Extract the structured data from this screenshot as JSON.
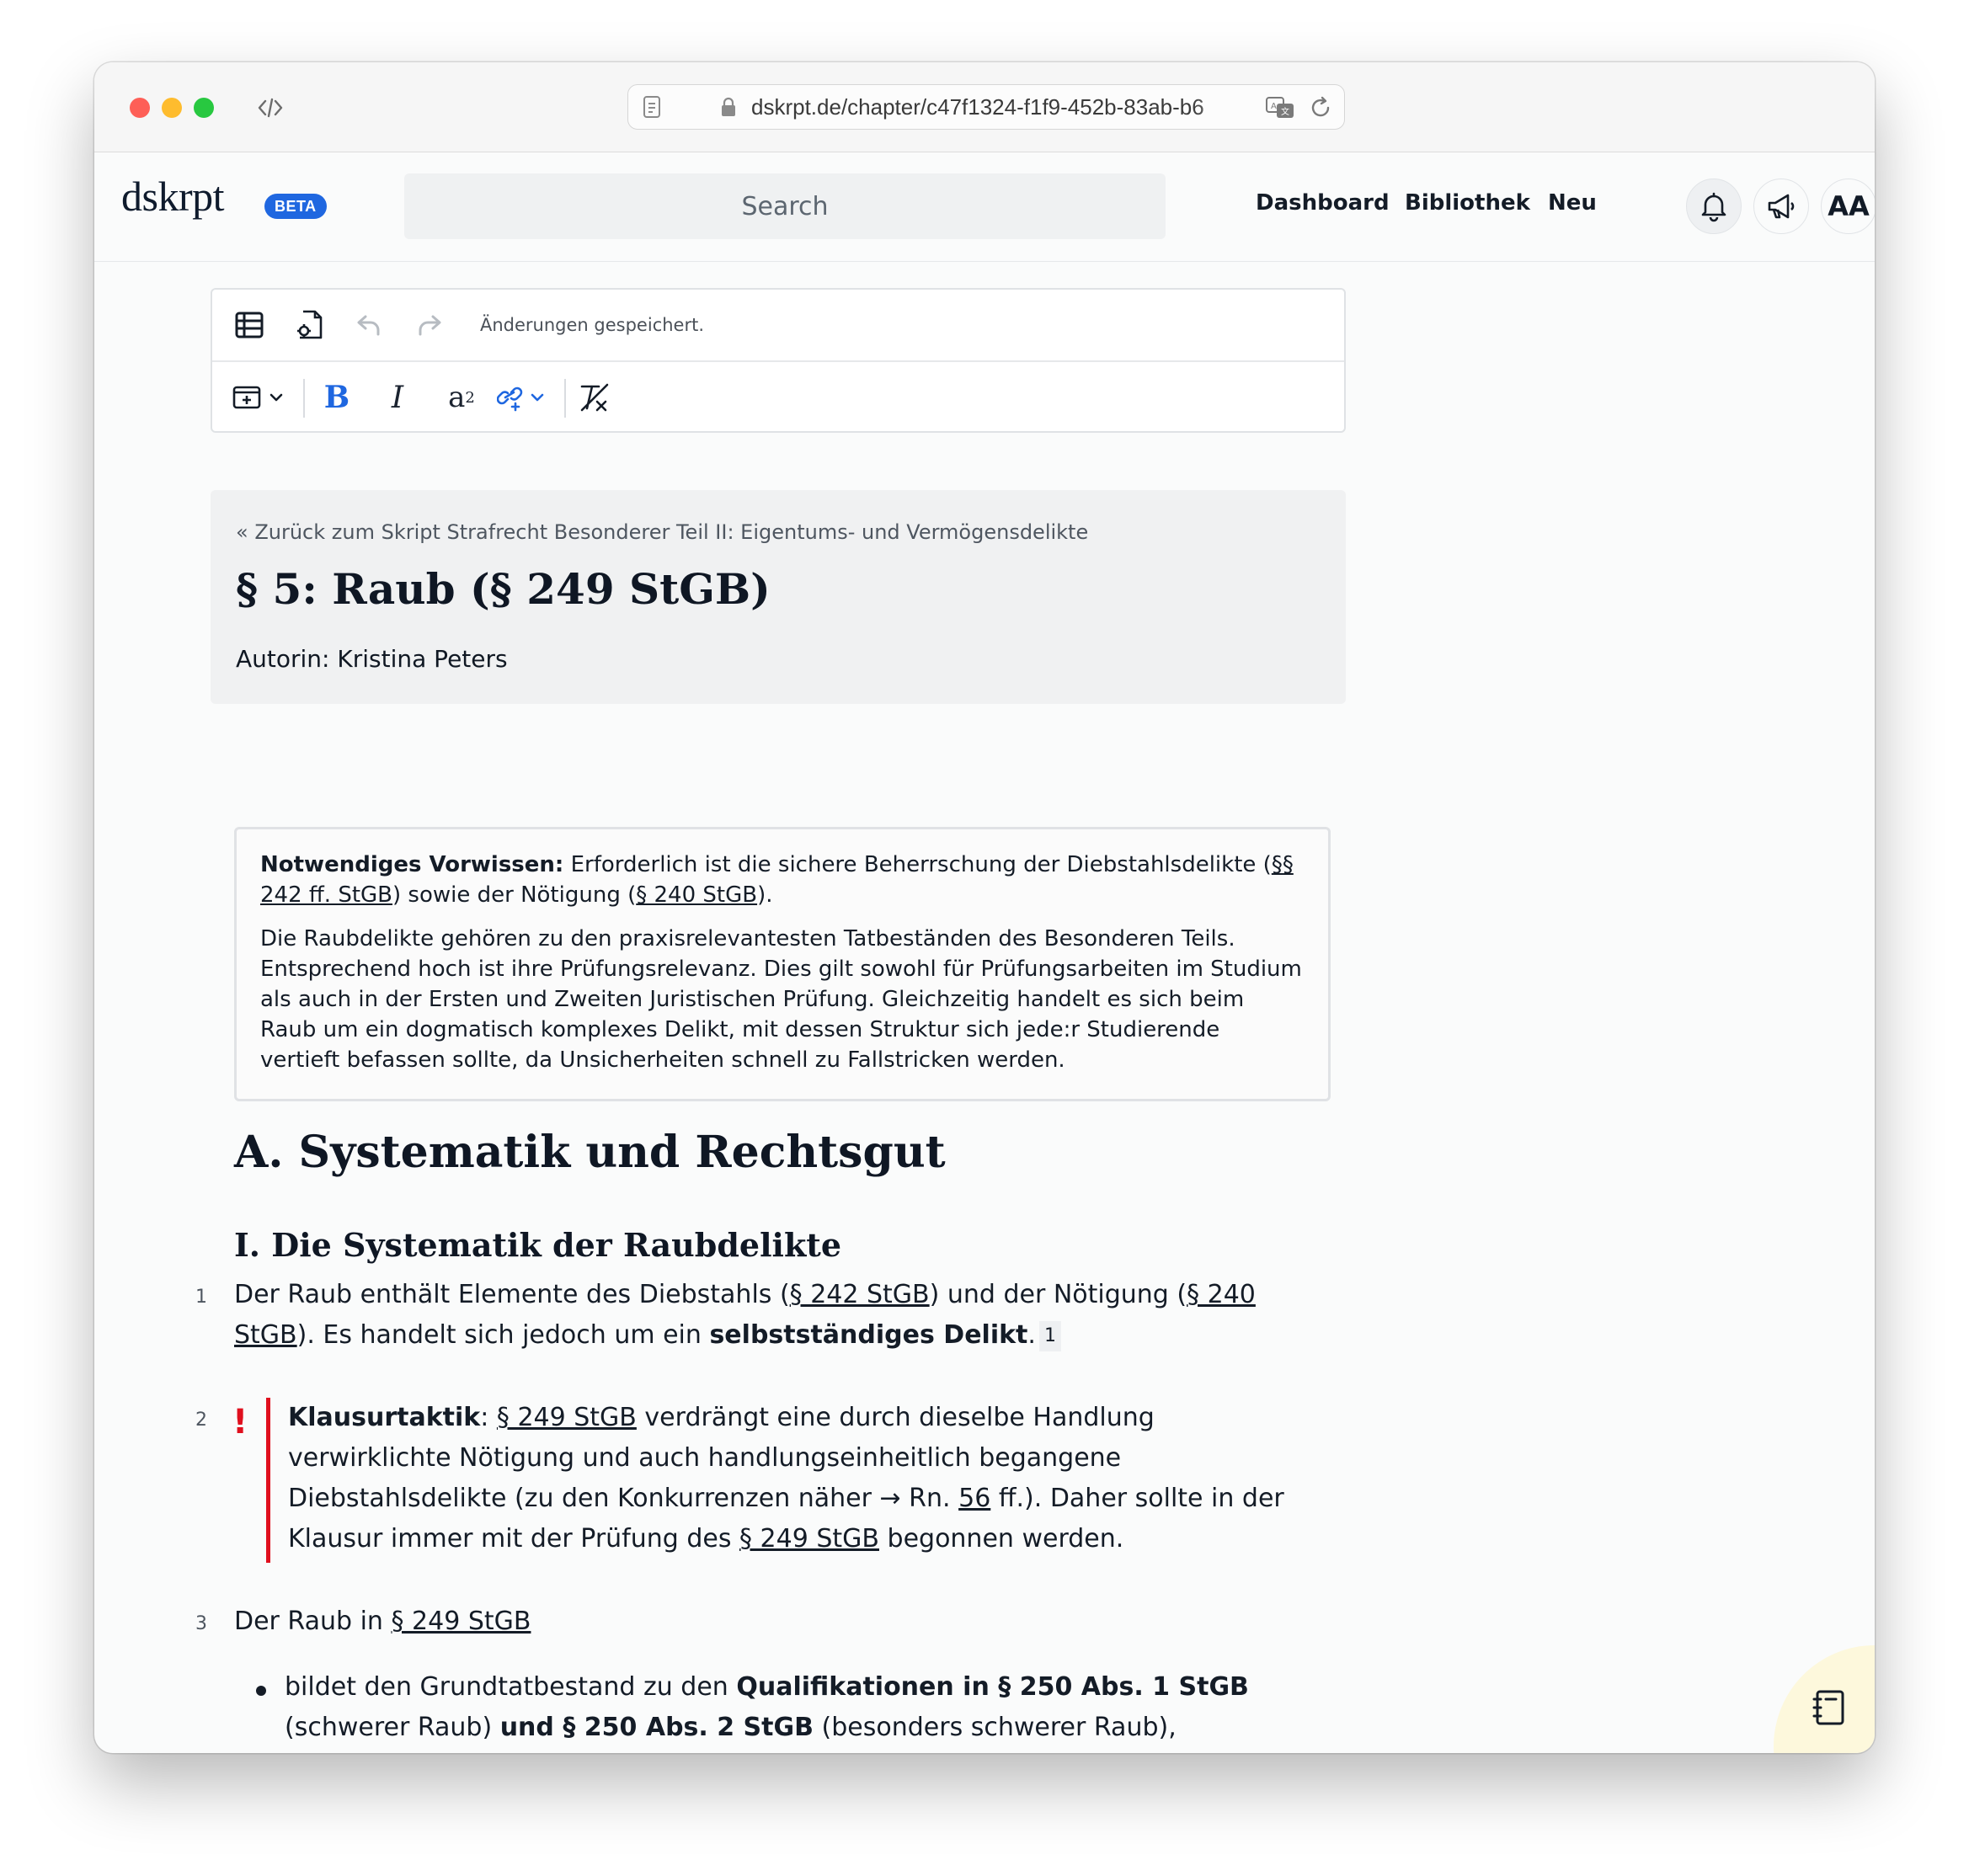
{
  "browser": {
    "url": "dskrpt.de/chapter/c47f1324-f1f9-452b-83ab-b6"
  },
  "header": {
    "logo": "dskrpt",
    "badge": "BETA",
    "search_placeholder": "Search",
    "nav": [
      "Dashboard",
      "Bibliothek",
      "Neu"
    ],
    "font_button": "AA"
  },
  "toolbar": {
    "status": "Änderungen gespeichert."
  },
  "chapter": {
    "back_link": "« Zurück zum Skript Strafrecht Besonderer Teil II: Eigentums- und Vermögensdelikte",
    "title": "§ 5: Raub (§ 249 StGB)",
    "author": "Autorin: Kristina Peters"
  },
  "infobox": {
    "label": "Notwendiges Vorwissen:",
    "text1": " Erforderlich ist die sichere Beherrschung der Diebstahlsdelikte (",
    "link1": "§§ 242 ff. StGB",
    "text2": ") sowie der Nötigung (",
    "link2": "§ 240 StGB",
    "text3": ").",
    "paragraph": "Die Raubdelikte gehören zu den praxisrelevantesten Tatbeständen des Besonderen Teils. Entsprechend hoch ist ihre Prüfungsrelevanz. Dies gilt sowohl für Prüfungsarbeiten im Studium als auch in der Ersten und Zweiten Juristischen Prüfung. Gleichzeitig handelt es sich beim Raub um ein dogmatisch komplexes Delikt, mit dessen Struktur sich jede:r Studierende vertieft befassen sollte, da Unsicherheiten schnell zu Fallstricken werden."
  },
  "content": {
    "h1": "A. Systematik und Rechtsgut",
    "h2": "I. Die Systematik der Raubdelikte",
    "rn1": {
      "number": "1",
      "t1": "Der Raub enthält Elemente des Diebstahls (",
      "l1": "§ 242 StGB",
      "t2": ") und der Nötigung (",
      "l2": "§ 240 StGB",
      "t3": "). Es handelt sich jedoch um ein ",
      "bold": "selbstständiges Delikt",
      "t4": ".",
      "footnote": "1"
    },
    "rn2": {
      "number": "2",
      "mark": "!",
      "label": "Klausurtaktik",
      "t1": ": ",
      "l1": "§ 249 StGB",
      "t2": " verdrängt eine durch dieselbe Handlung verwirklichte Nötigung und auch handlungseinheitlich begangene Diebstahlsdelikte (zu den Konkurrenzen näher → Rn. ",
      "l2": "56",
      "t3": " ff.). Daher sollte in der Klausur immer mit der Prüfung des ",
      "l3": "§ 249 StGB",
      "t4": " begonnen werden."
    },
    "rn3": {
      "number": "3",
      "t1": "Der Raub in ",
      "l1": "§ 249 StGB",
      "bullet": {
        "t1": "bildet den Grundtatbestand zu den ",
        "b1": "Qualifikationen in § 250 Abs. 1 StGB",
        "t2": " (schwerer Raub) ",
        "b2": "und § 250 Abs. 2 StGB",
        "t3": " (besonders schwerer Raub),"
      }
    }
  },
  "colors": {
    "accent": "#1f67e0",
    "warning": "#e0101e",
    "notes_fab": "#fdf8dc"
  }
}
